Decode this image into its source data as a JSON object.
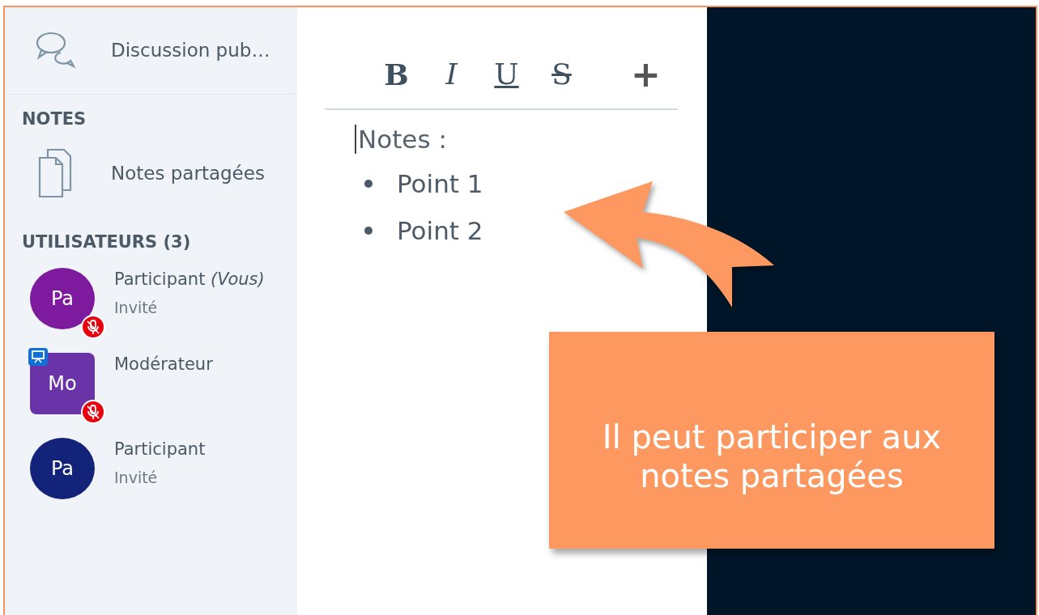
{
  "sidebar": {
    "chat_item": {
      "label": "Discussion pub…"
    },
    "notes_section": {
      "heading": "NOTES",
      "item": {
        "label": "Notes partagées"
      }
    },
    "users_section": {
      "heading": "UTILISATEURS (3)",
      "users": [
        {
          "initials": "Pa",
          "name": "Participant *(Vous)*",
          "role": "Invité",
          "kind": "circle",
          "color": "#7e1a9e",
          "muted": true,
          "presenter": false
        },
        {
          "initials": "Mo",
          "name": "Modérateur",
          "kind": "square",
          "color": "#6a34a8",
          "muted": true,
          "presenter": true
        },
        {
          "initials": "Pa",
          "name": "Participant",
          "role": "Invité",
          "kind": "circle",
          "color": "#13237a",
          "muted": false,
          "presenter": false
        }
      ]
    }
  },
  "editor": {
    "toolbar": [
      {
        "kind": "bold",
        "label": "B"
      },
      {
        "kind": "italic",
        "label": "I"
      },
      {
        "kind": "underline",
        "label": "U"
      },
      {
        "kind": "strike",
        "label": "S"
      },
      {
        "kind": "plus",
        "label": "+"
      }
    ],
    "heading": "Notes :",
    "bullets": [
      "Point 1",
      "Point 2"
    ]
  },
  "callout": {
    "text": "Il peut participer aux notes partagées"
  }
}
